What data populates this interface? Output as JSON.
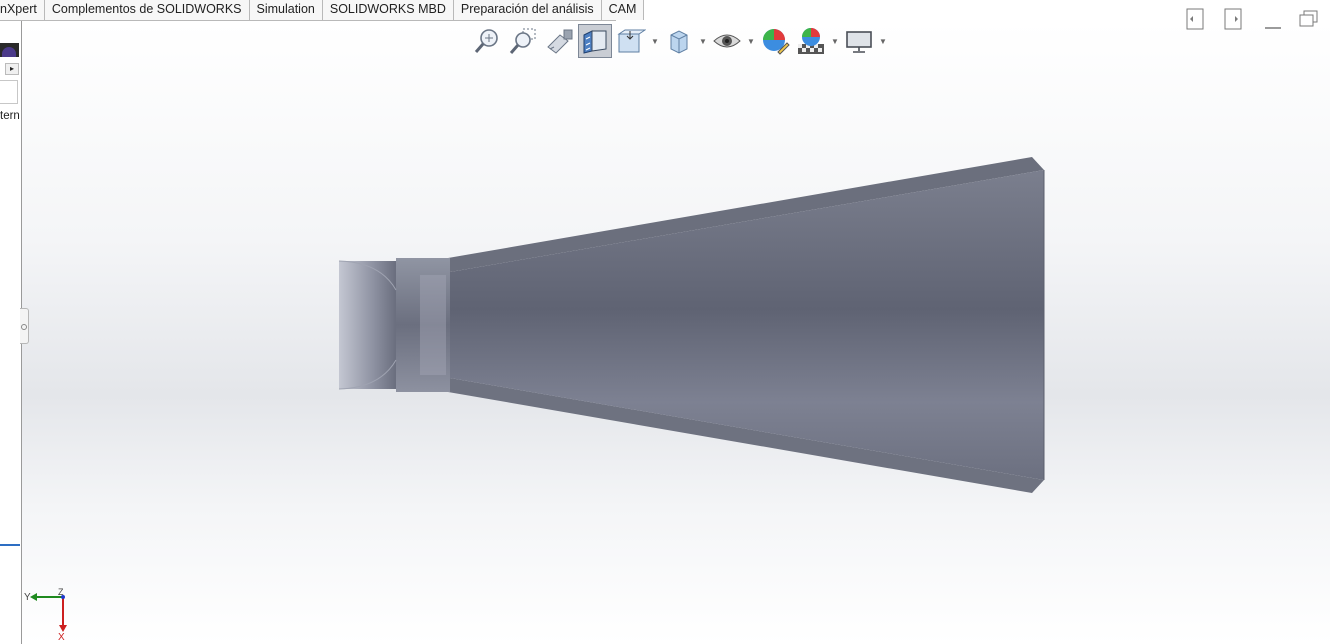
{
  "tabs": [
    "nXpert",
    "Complementos de SOLIDWORKS",
    "Simulation",
    "SOLIDWORKS MBD",
    "Preparación del análisis",
    "CAM"
  ],
  "left_panel": {
    "truncated_text": "tern"
  },
  "heads_up_toolbar": [
    {
      "name": "zoom-to-fit-icon"
    },
    {
      "name": "zoom-to-area-icon"
    },
    {
      "name": "previous-view-icon"
    },
    {
      "name": "section-view-icon",
      "active": true
    },
    {
      "name": "dynamic-annotation-views-icon",
      "dropdown": true
    },
    {
      "name": "view-orientation-icon",
      "dropdown": true
    },
    {
      "name": "hide-show-items-icon",
      "dropdown": true
    },
    {
      "name": "edit-appearance-icon"
    },
    {
      "name": "apply-scene-icon",
      "dropdown": true
    },
    {
      "name": "view-settings-icon",
      "dropdown": true
    }
  ],
  "triad": {
    "axis_y": "Y",
    "axis_z": "Z",
    "axis_x": "X"
  },
  "colors": {
    "part_face": "#6e7282",
    "part_edge": "#8a8e9c",
    "triad_x": "#cc1f1f",
    "triad_y": "#1f8a1f",
    "triad_z": "#1f3acc"
  }
}
